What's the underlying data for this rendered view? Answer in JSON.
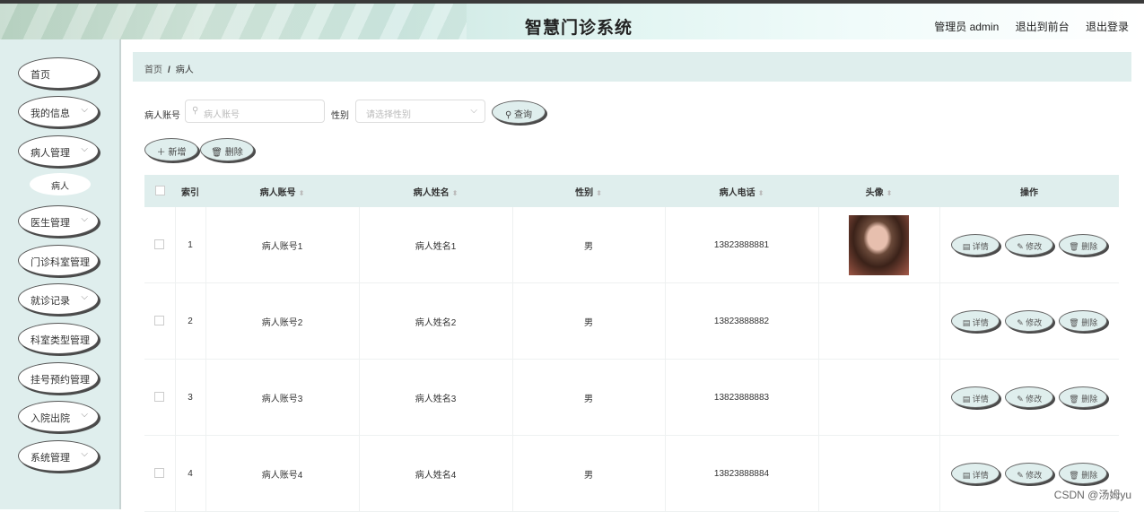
{
  "header": {
    "title": "智慧门诊系统",
    "admin_label": "管理员 admin",
    "to_front": "退出到前台",
    "logout": "退出登录"
  },
  "sidebar": {
    "items": [
      {
        "label": "首页",
        "has_children": false
      },
      {
        "label": "我的信息",
        "has_children": true
      },
      {
        "label": "病人管理",
        "has_children": true,
        "expanded": true
      },
      {
        "label": "医生管理",
        "has_children": true
      },
      {
        "label": "门诊科室管理",
        "has_children": true
      },
      {
        "label": "就诊记录",
        "has_children": true
      },
      {
        "label": "科室类型管理",
        "has_children": true
      },
      {
        "label": "挂号预约管理",
        "has_children": true
      },
      {
        "label": "入院出院",
        "has_children": true
      },
      {
        "label": "系统管理",
        "has_children": true
      }
    ],
    "submenu_item": "病人"
  },
  "breadcrumb": {
    "home": "首页",
    "separator": "/",
    "current": "病人"
  },
  "search": {
    "account_label": "病人账号",
    "account_placeholder": "病人账号",
    "gender_label": "性别",
    "gender_placeholder": "请选择性别",
    "query_button": "查询"
  },
  "actions": {
    "add": "新增",
    "delete": "删除"
  },
  "table": {
    "headers": {
      "index": "索引",
      "account": "病人账号",
      "name": "病人姓名",
      "gender": "性别",
      "phone": "病人电话",
      "avatar": "头像",
      "ops": "操作"
    },
    "row_buttons": {
      "detail": "详情",
      "edit": "修改",
      "delete": "删除"
    },
    "rows": [
      {
        "index": "1",
        "account": "病人账号1",
        "name": "病人姓名1",
        "gender": "男",
        "phone": "13823888881",
        "has_avatar": true
      },
      {
        "index": "2",
        "account": "病人账号2",
        "name": "病人姓名2",
        "gender": "男",
        "phone": "13823888882",
        "has_avatar": false
      },
      {
        "index": "3",
        "account": "病人账号3",
        "name": "病人姓名3",
        "gender": "男",
        "phone": "13823888883",
        "has_avatar": false
      },
      {
        "index": "4",
        "account": "病人账号4",
        "name": "病人姓名4",
        "gender": "男",
        "phone": "13823888884",
        "has_avatar": false
      }
    ]
  },
  "watermark": "CSDN @汤姆yu",
  "colors": {
    "panel": "#dfeeed",
    "button_border": "#666666",
    "accent_shadow": "#4a4a4a"
  },
  "icons": {
    "search": "search-icon",
    "add": "plus-icon",
    "delete": "trash-icon",
    "detail": "document-icon",
    "edit": "pencil-icon",
    "sort": "sort-icon",
    "dropdown": "chevron-down-icon"
  }
}
